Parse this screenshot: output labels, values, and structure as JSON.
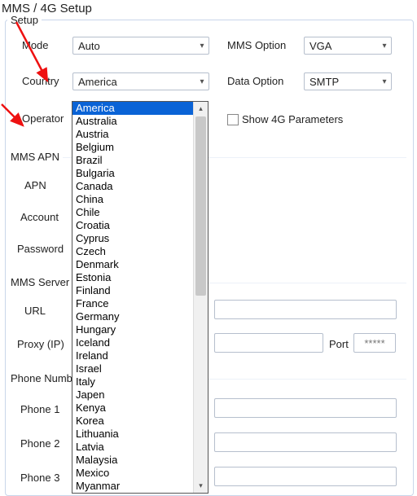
{
  "title": "MMS / 4G Setup",
  "sections": {
    "setup": "Setup",
    "mms_apn": "MMS APN",
    "mms_server": "MMS Server",
    "phone_number": "Phone Number"
  },
  "labels": {
    "mode": "Mode",
    "country": "Country",
    "operator": "Operator",
    "mms_option": "MMS Option",
    "data_option": "Data Option",
    "show4g": "Show 4G Parameters",
    "apn": "APN",
    "account": "Account",
    "password": "Password",
    "url": "URL",
    "proxy": "Proxy (IP)",
    "port": "Port",
    "phone1": "Phone 1",
    "phone2": "Phone 2",
    "phone3": "Phone 3"
  },
  "values": {
    "mode": "Auto",
    "country": "America",
    "mms_option": "VGA",
    "data_option": "SMTP",
    "port": "*****"
  },
  "country_options": [
    "America",
    "Australia",
    "Austria",
    "Belgium",
    "Brazil",
    "Bulgaria",
    "Canada",
    "China",
    "Chile",
    "Croatia",
    "Cyprus",
    "Czech",
    "Denmark",
    "Estonia",
    "Finland",
    "France",
    "Germany",
    "Hungary",
    "Iceland",
    "Ireland",
    "Israel",
    "Italy",
    "Japen",
    "Kenya",
    "Korea",
    "Lithuania",
    "Latvia",
    "Malaysia",
    "Mexico",
    "Myanmar"
  ],
  "country_selected": "America"
}
